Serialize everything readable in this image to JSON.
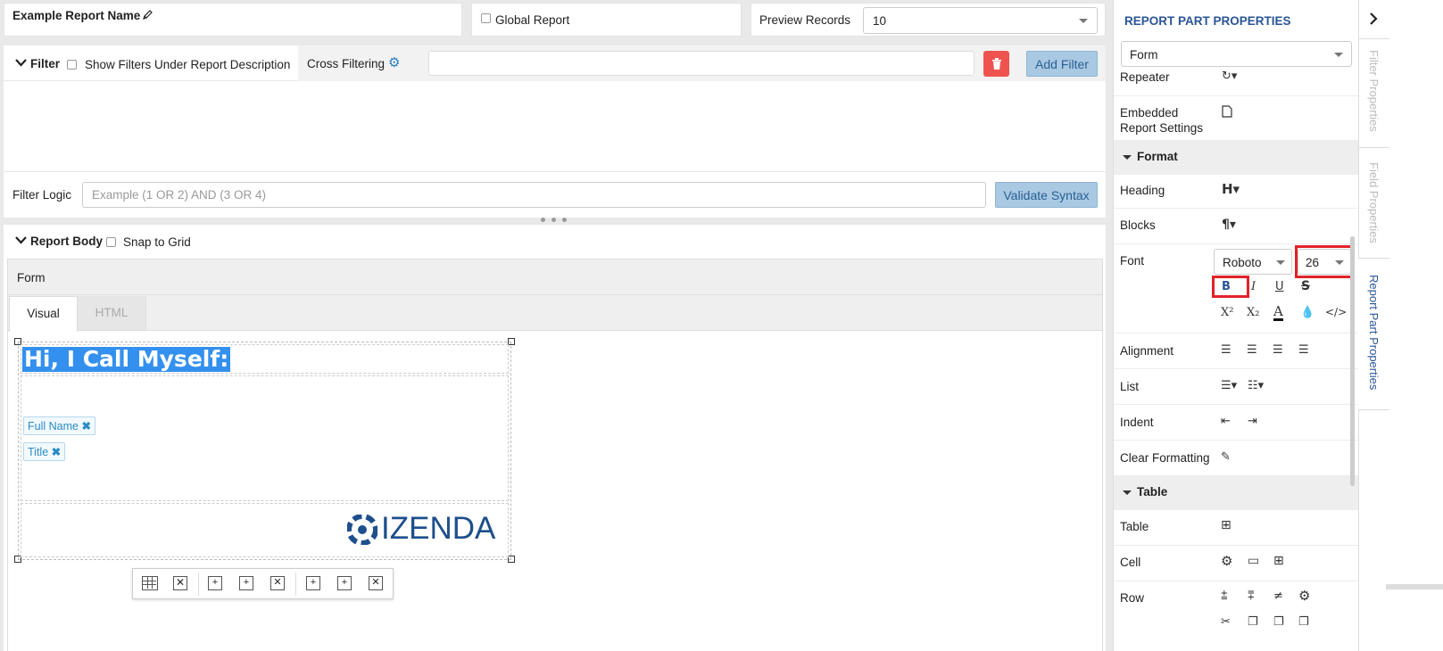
{
  "header": {
    "report_name": "Example Report Name",
    "global_report_label": "Global Report",
    "preview_records_label": "Preview Records",
    "preview_records_value": "10"
  },
  "filter": {
    "title": "Filter",
    "show_filters_label": "Show Filters Under Report Description",
    "cross_filtering_label": "Cross Filtering",
    "add_filter_label": "Add Filter",
    "filter_logic_label": "Filter Logic",
    "filter_logic_placeholder": "Example (1 OR 2) AND (3 OR 4)",
    "validate_label": "Validate Syntax"
  },
  "report_body": {
    "title": "Report Body",
    "snap_label": "Snap to Grid",
    "form_label": "Form",
    "tabs": [
      "Visual",
      "HTML"
    ],
    "heading_text": "Hi, I Call Myself:",
    "fields": [
      "Full Name",
      "Title"
    ],
    "logo_text": "IZENDA"
  },
  "right_panel": {
    "title": "REPORT PART PROPERTIES",
    "part_type": "Form",
    "rows": {
      "repeater": "Repeater",
      "embedded": "Embedded Report Settings",
      "heading": "Heading",
      "blocks": "Blocks",
      "font": "Font",
      "font_family": "Roboto",
      "font_size": "26",
      "alignment": "Alignment",
      "list": "List",
      "indent": "Indent",
      "clear_formatting": "Clear Formatting",
      "table": "Table",
      "cell": "Cell",
      "row": "Row"
    },
    "sections": {
      "format": "Format",
      "table": "Table"
    },
    "vertical_tabs": [
      "Filter Properties",
      "Field Properties",
      "Report Part Properties"
    ]
  },
  "colors": {
    "accent": "#2a5595",
    "selection": "#3390ee",
    "highlight": "#e32229",
    "delete": "#ef5350",
    "button_blue": "#a9c9e3",
    "izenda": "#1d4f8c"
  }
}
